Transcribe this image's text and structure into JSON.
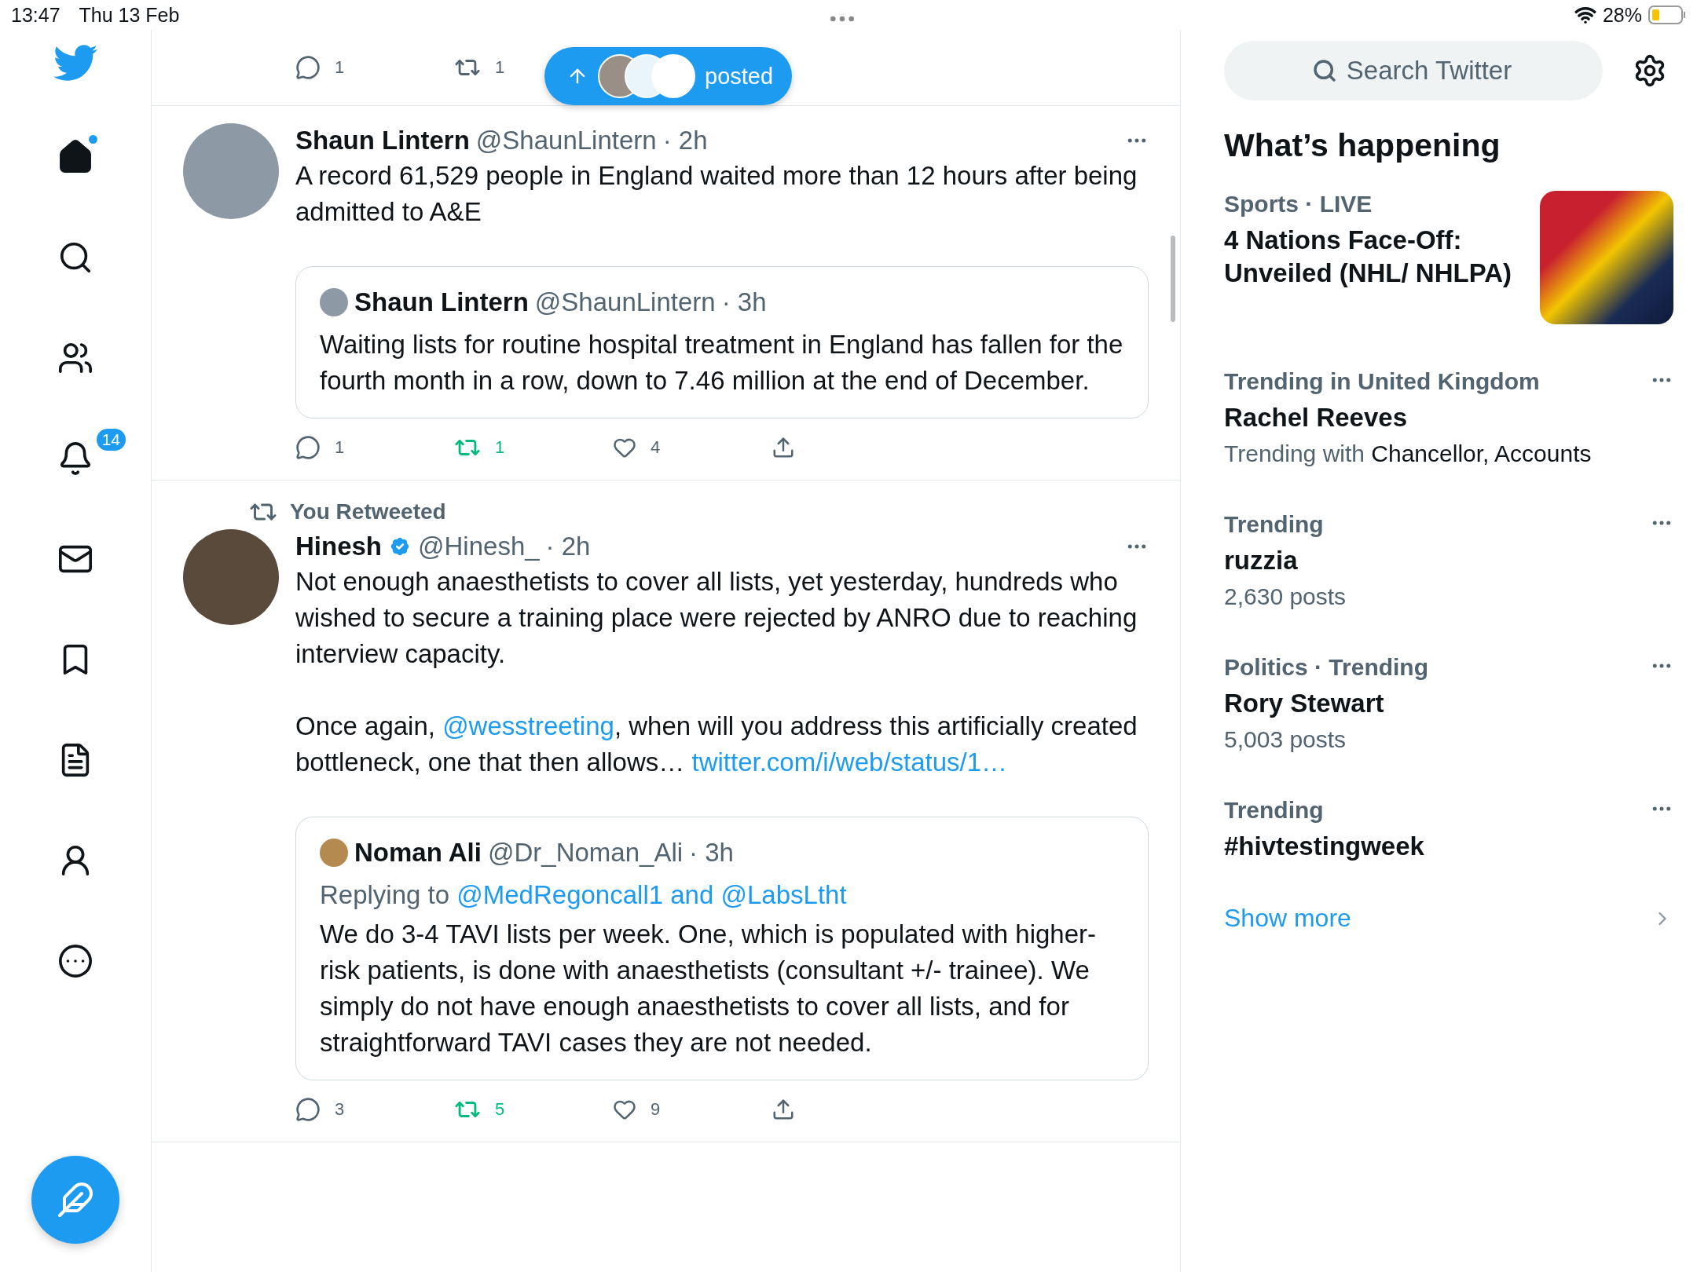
{
  "status_bar": {
    "time": "13:47",
    "date": "Thu 13 Feb",
    "battery": "28%"
  },
  "sidebar": {
    "items": [
      {
        "kind": "home",
        "dot": true,
        "selected": true
      },
      {
        "kind": "search",
        "dot": false,
        "selected": false
      },
      {
        "kind": "communities",
        "dot": false,
        "selected": false
      },
      {
        "kind": "notifications",
        "dot": false,
        "selected": false,
        "badge": "14"
      },
      {
        "kind": "messages",
        "dot": false,
        "selected": false
      },
      {
        "kind": "bookmarks",
        "dot": false,
        "selected": false
      },
      {
        "kind": "lists",
        "dot": false,
        "selected": false
      },
      {
        "kind": "profile",
        "dot": false,
        "selected": false
      },
      {
        "kind": "more",
        "dot": false,
        "selected": false
      }
    ]
  },
  "new_posts_pill": {
    "label": "posted"
  },
  "previous_tweet_actions": {
    "replies": "1",
    "retweets": "1",
    "retweeted": false
  },
  "tweets": [
    {
      "author": "Shaun Lintern",
      "verified": false,
      "handle": "@ShaunLintern",
      "time": "· 2h",
      "paragraphs": [
        [
          {
            "text": "A record 61,529 people in England waited more than 12 hours after being admitted to A&E"
          }
        ]
      ],
      "quote": {
        "author": "Shaun Lintern",
        "handle": "@ShaunLintern",
        "time": "· 3h",
        "text": "Waiting lists for routine hospital treatment in England has fallen for the fourth month in a row, down to 7.46 million at the end of December."
      },
      "actions": {
        "replies": "1",
        "retweets": "1",
        "retweeted": true,
        "likes": "4"
      }
    },
    {
      "social_context": "You Retweeted",
      "author": "Hinesh",
      "verified": true,
      "handle": "@Hinesh_",
      "time": "· 2h",
      "paragraphs": [
        [
          {
            "text": "Not enough anaesthetists to cover all lists, yet yesterday, hundreds who wished to secure a training place were rejected by ANRO due to reaching interview capacity."
          }
        ],
        [
          {
            "text": "Once again, "
          },
          {
            "text": "@wesstreeting",
            "kind": "link"
          },
          {
            "text": ", when will you address this artificially created bottleneck, one that then allows… "
          },
          {
            "text": "twitter.com/i/web/status/1…",
            "kind": "link"
          }
        ]
      ],
      "quote": {
        "author": "Noman Ali",
        "handle": "@Dr_Noman_Ali",
        "time": "· 3h",
        "replying_prefix": "Replying to",
        "replying_to": "@MedRegoncall1 and @LabsLtht",
        "text": "We do 3-4 TAVI lists per week. One, which is populated with higher-risk patients, is done with anaesthetists (consultant +/- trainee). We simply do not have enough anaesthetists to cover all lists, and for straightforward TAVI cases they are not needed."
      },
      "actions": {
        "replies": "3",
        "retweets": "5",
        "retweeted": true,
        "likes": "9"
      }
    }
  ],
  "right_panel": {
    "search": {
      "placeholder": "Search Twitter"
    },
    "heading": "What’s happening",
    "trends": [
      {
        "context": "Sports · LIVE",
        "title": "4 Nations Face-Off: Unveiled (NHL/ NHLPA)",
        "has_image": true
      },
      {
        "context": "Trending in United Kingdom",
        "title": "Rachel Reeves",
        "with_prefix": "Trending with",
        "with_names": "Chancellor, Accounts"
      },
      {
        "context": "Trending",
        "title": "ruzzia",
        "posts": "2,630 posts"
      },
      {
        "context": "Politics · Trending",
        "title": "Rory Stewart",
        "posts": "5,003 posts"
      },
      {
        "context": "Trending",
        "title": "#hivtestingweek"
      }
    ],
    "show_more": "Show more"
  }
}
